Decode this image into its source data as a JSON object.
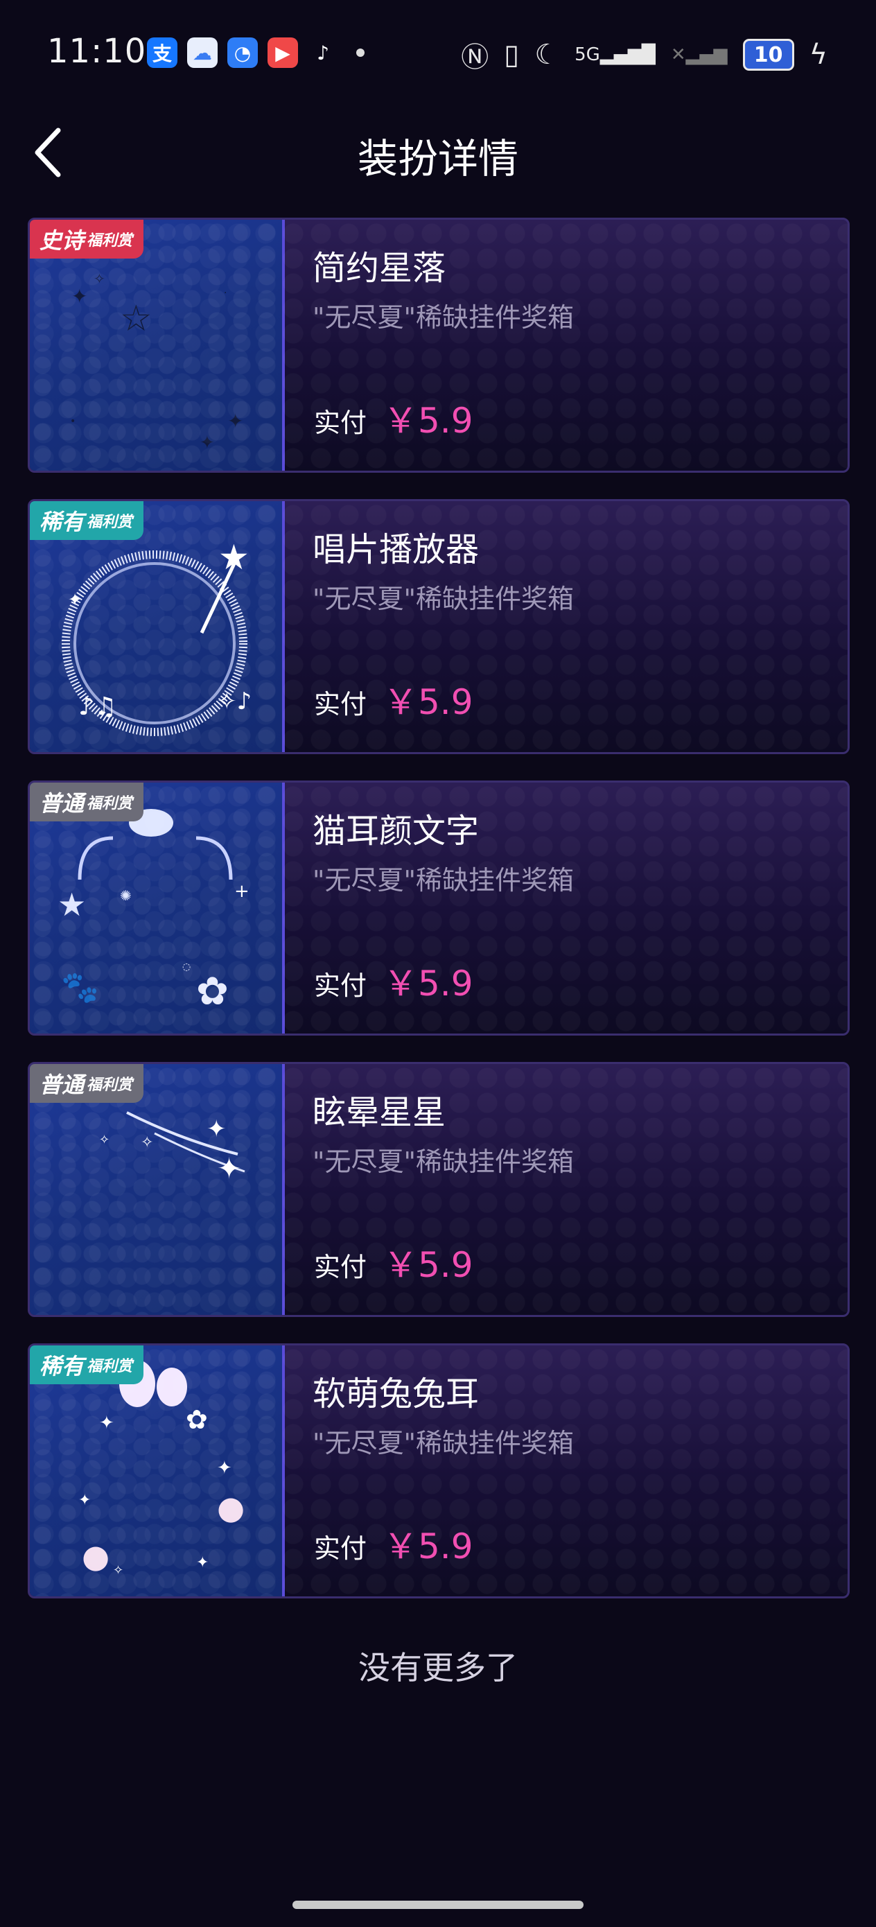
{
  "status_bar": {
    "time": "11:10",
    "signal_label": "5G",
    "battery": "10",
    "app_icons": [
      "alipay-icon",
      "baidu-netdisk-icon",
      "qq-icon",
      "video-icon",
      "tiktok-icon"
    ],
    "system_icons": [
      "nfc-icon",
      "vibrate-icon",
      "moon-icon",
      "signal-icon",
      "no-signal-icon",
      "battery-icon",
      "charging-icon"
    ]
  },
  "header": {
    "title": "装扮详情",
    "back_icon": "chevron-left-icon"
  },
  "items": [
    {
      "badge": "史诗",
      "badge_suffix": "福利赏",
      "badge_type": "epic",
      "name": "简约星落",
      "desc": "\"无尽夏\"稀缺挂件奖箱",
      "pay_label": "实付",
      "price": "￥5.9",
      "art": "star-falls"
    },
    {
      "badge": "稀有",
      "badge_suffix": "福利赏",
      "badge_type": "rare",
      "name": "唱片播放器",
      "desc": "\"无尽夏\"稀缺挂件奖箱",
      "pay_label": "实付",
      "price": "￥5.9",
      "art": "record-ring"
    },
    {
      "badge": "普通",
      "badge_suffix": "福利赏",
      "badge_type": "common",
      "name": "猫耳颜文字",
      "desc": "\"无尽夏\"稀缺挂件奖箱",
      "pay_label": "实付",
      "price": "￥5.9",
      "art": "cat-ears"
    },
    {
      "badge": "普通",
      "badge_suffix": "福利赏",
      "badge_type": "common",
      "name": "眩晕星星",
      "desc": "\"无尽夏\"稀缺挂件奖箱",
      "pay_label": "实付",
      "price": "￥5.9",
      "art": "dizzy-stars"
    },
    {
      "badge": "稀有",
      "badge_suffix": "福利赏",
      "badge_type": "rare",
      "name": "软萌兔兔耳",
      "desc": "\"无尽夏\"稀缺挂件奖箱",
      "pay_label": "实付",
      "price": "￥5.9",
      "art": "bunny-ears"
    }
  ],
  "footer": {
    "end_text": "没有更多了"
  },
  "colors": {
    "background": "#0b0818",
    "price": "#f24fb2",
    "epic": "#d9344f",
    "rare": "#22a6a9",
    "common": "#6c6c78"
  }
}
